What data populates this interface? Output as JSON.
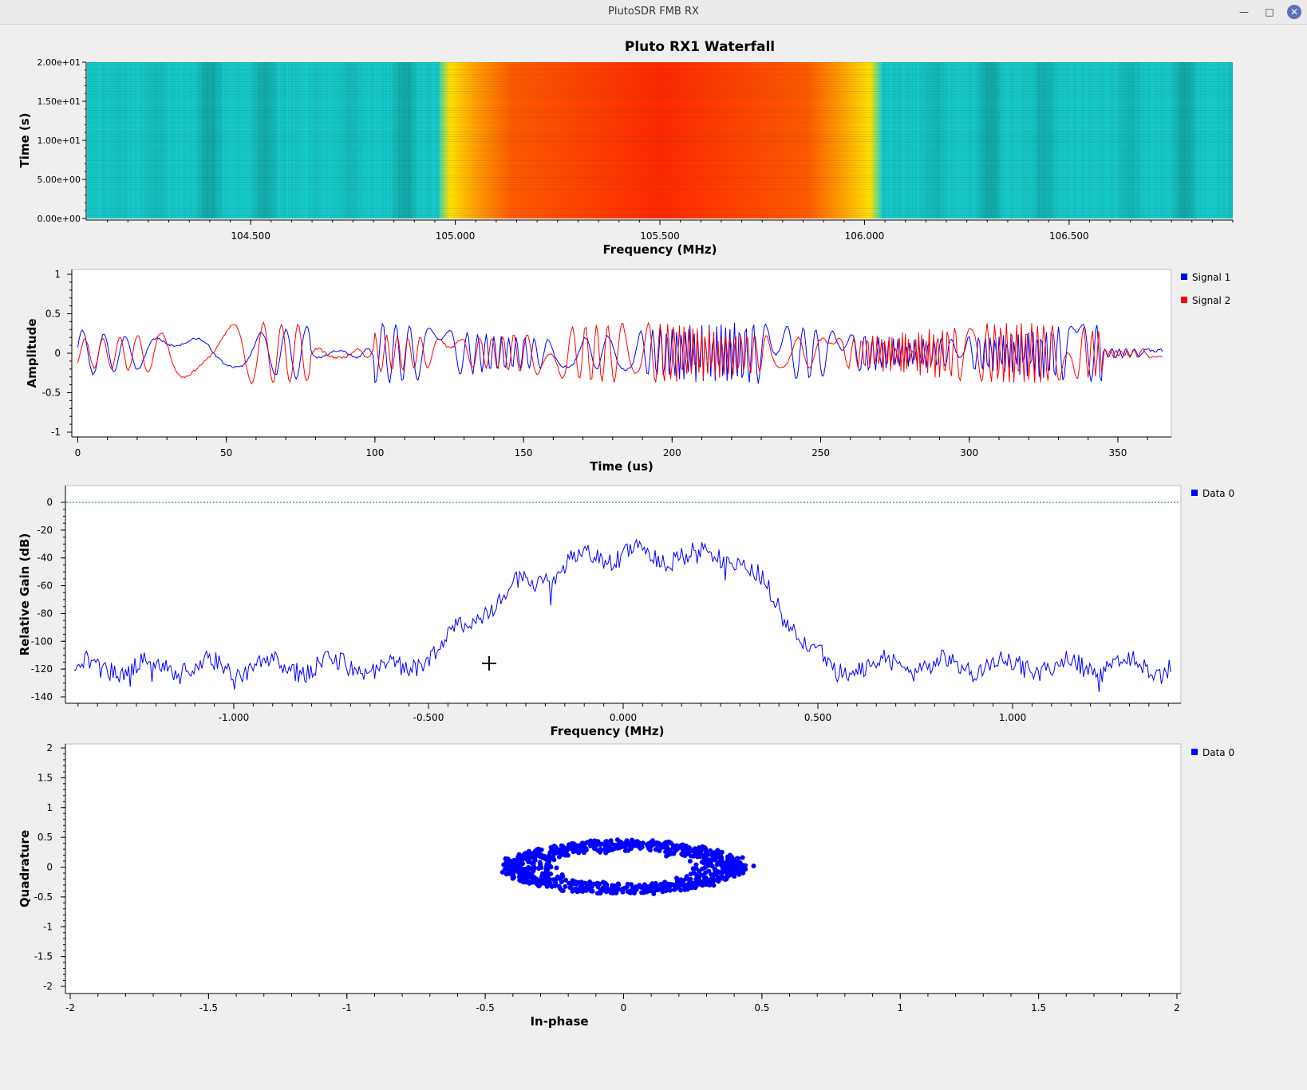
{
  "window": {
    "title": "PlutoSDR FMB RX",
    "minimize_icon": "minimize-icon",
    "maximize_icon": "maximize-icon",
    "close_icon": "close-icon"
  },
  "cursor": {
    "icon": "crosshair-cursor-icon"
  },
  "chart_data": [
    {
      "type": "heatmap",
      "title": "Pluto RX1 Waterfall",
      "xlabel": "Frequency (MHz)",
      "ylabel": "Time (s)",
      "xlim": [
        104.1,
        106.9
      ],
      "ylim": [
        0,
        20
      ],
      "xticks": [
        {
          "v": 104.5,
          "label": "104.500"
        },
        {
          "v": 105.0,
          "label": "105.000"
        },
        {
          "v": 105.5,
          "label": "105.500"
        },
        {
          "v": 106.0,
          "label": "106.000"
        },
        {
          "v": 106.5,
          "label": "106.500"
        }
      ],
      "yticks": [
        {
          "v": 0,
          "label": "0.00e+00"
        },
        {
          "v": 5,
          "label": "5.00e+00"
        },
        {
          "v": 10,
          "label": "1.00e+01"
        },
        {
          "v": 15,
          "label": "1.50e+01"
        },
        {
          "v": 20,
          "label": "2.00e+01"
        }
      ],
      "signal_band_mhz": [
        104.97,
        106.03
      ],
      "colors": {
        "noise": "#18d2d2",
        "mid": "#ffe000",
        "strong": "#ff2800"
      }
    },
    {
      "type": "line",
      "xlabel": "Time (us)",
      "ylabel": "Amplitude",
      "xlim": [
        -2,
        368
      ],
      "ylim": [
        -1,
        1
      ],
      "xticks": [
        0,
        50,
        100,
        150,
        200,
        250,
        300,
        350
      ],
      "yticks": [
        {
          "v": -1,
          "label": "-1"
        },
        {
          "v": -0.5,
          "label": "-0.5"
        },
        {
          "v": 0,
          "label": "0"
        },
        {
          "v": 0.5,
          "label": "0.5"
        },
        {
          "v": 1,
          "label": "1"
        }
      ],
      "series": [
        {
          "name": "Signal 1",
          "color": "#0000ff"
        },
        {
          "name": "Signal 2",
          "color": "#ff0000"
        }
      ],
      "legend": "right"
    },
    {
      "type": "line",
      "xlabel": "Frequency (MHz)",
      "ylabel": "Relative Gain (dB)",
      "xlim": [
        -1.42,
        1.42
      ],
      "ylim": [
        -140,
        10
      ],
      "xticks": [
        {
          "v": -1.0,
          "label": "-1.000"
        },
        {
          "v": -0.5,
          "label": "-0.500"
        },
        {
          "v": 0.0,
          "label": "0.000"
        },
        {
          "v": 0.5,
          "label": "0.500"
        },
        {
          "v": 1.0,
          "label": "1.000"
        }
      ],
      "yticks": [
        -140,
        -120,
        -100,
        -80,
        -60,
        -40,
        -20,
        0
      ],
      "reference_line_db": 0,
      "series": [
        {
          "name": "Data 0",
          "color": "#0000ff"
        }
      ],
      "legend": "right"
    },
    {
      "type": "scatter",
      "xlabel": "In-phase",
      "ylabel": "Quadrature",
      "xlim": [
        -2,
        2
      ],
      "ylim": [
        -2,
        2
      ],
      "xticks": [
        {
          "v": -2,
          "label": "-2"
        },
        {
          "v": -1.5,
          "label": "-1.5"
        },
        {
          "v": -1,
          "label": "-1"
        },
        {
          "v": -0.5,
          "label": "-0.5"
        },
        {
          "v": 0,
          "label": "0"
        },
        {
          "v": 0.5,
          "label": "0.5"
        },
        {
          "v": 1,
          "label": "1"
        },
        {
          "v": 1.5,
          "label": "1.5"
        },
        {
          "v": 2,
          "label": "2"
        }
      ],
      "yticks": [
        {
          "v": -2,
          "label": "-2"
        },
        {
          "v": -1.5,
          "label": "-1.5"
        },
        {
          "v": -1,
          "label": "-1"
        },
        {
          "v": -0.5,
          "label": "-0.5"
        },
        {
          "v": 0,
          "label": "0"
        },
        {
          "v": 0.5,
          "label": "0.5"
        },
        {
          "v": 1,
          "label": "1"
        },
        {
          "v": 1.5,
          "label": "1.5"
        },
        {
          "v": 2,
          "label": "2"
        }
      ],
      "cluster": {
        "center": [
          0.0,
          0.0
        ],
        "i_extent": [
          -0.43,
          0.47
        ],
        "q_extent": [
          -0.47,
          0.47
        ]
      },
      "series": [
        {
          "name": "Data 0",
          "color": "#0000ff"
        }
      ],
      "legend": "right"
    }
  ]
}
